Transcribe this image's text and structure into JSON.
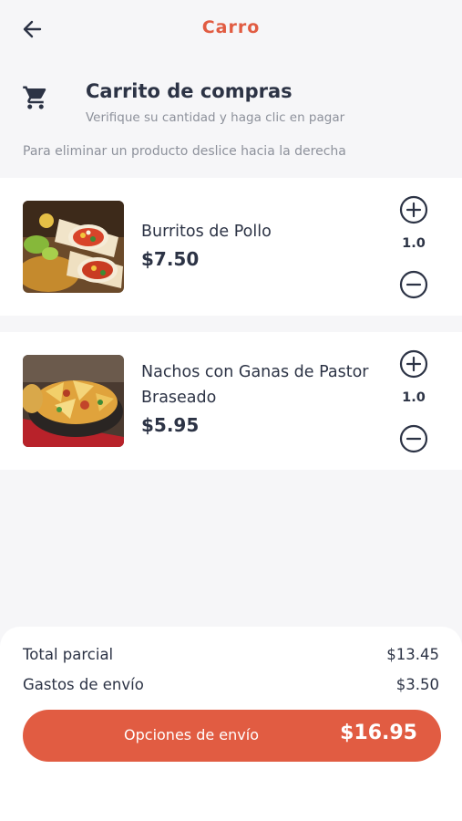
{
  "header": {
    "title": "Carro",
    "back_icon": "arrow-left-icon"
  },
  "cart": {
    "icon": "shopping-cart-icon",
    "title": "Carrito de compras",
    "subtitle": "Verifique su cantidad y haga clic en pagar",
    "hint": "Para eliminar un producto deslice hacia la derecha"
  },
  "items": [
    {
      "name": "Burritos de Pollo",
      "price": "$7.50",
      "quantity": "1.0",
      "image": "burritos-photo"
    },
    {
      "name": "Nachos con Ganas de Pastor Braseado",
      "price": "$5.95",
      "quantity": "1.0",
      "image": "nachos-photo"
    }
  ],
  "summary": {
    "subtotal_label": "Total parcial",
    "subtotal_value": "$13.45",
    "shipping_label": "Gastos de envío",
    "shipping_value": "$3.50",
    "button_label": "Opciones de envío",
    "button_total": "$16.95"
  },
  "colors": {
    "accent": "#e15c42",
    "text": "#2c3345",
    "muted": "#8d919b",
    "background": "#f6f6f8"
  }
}
